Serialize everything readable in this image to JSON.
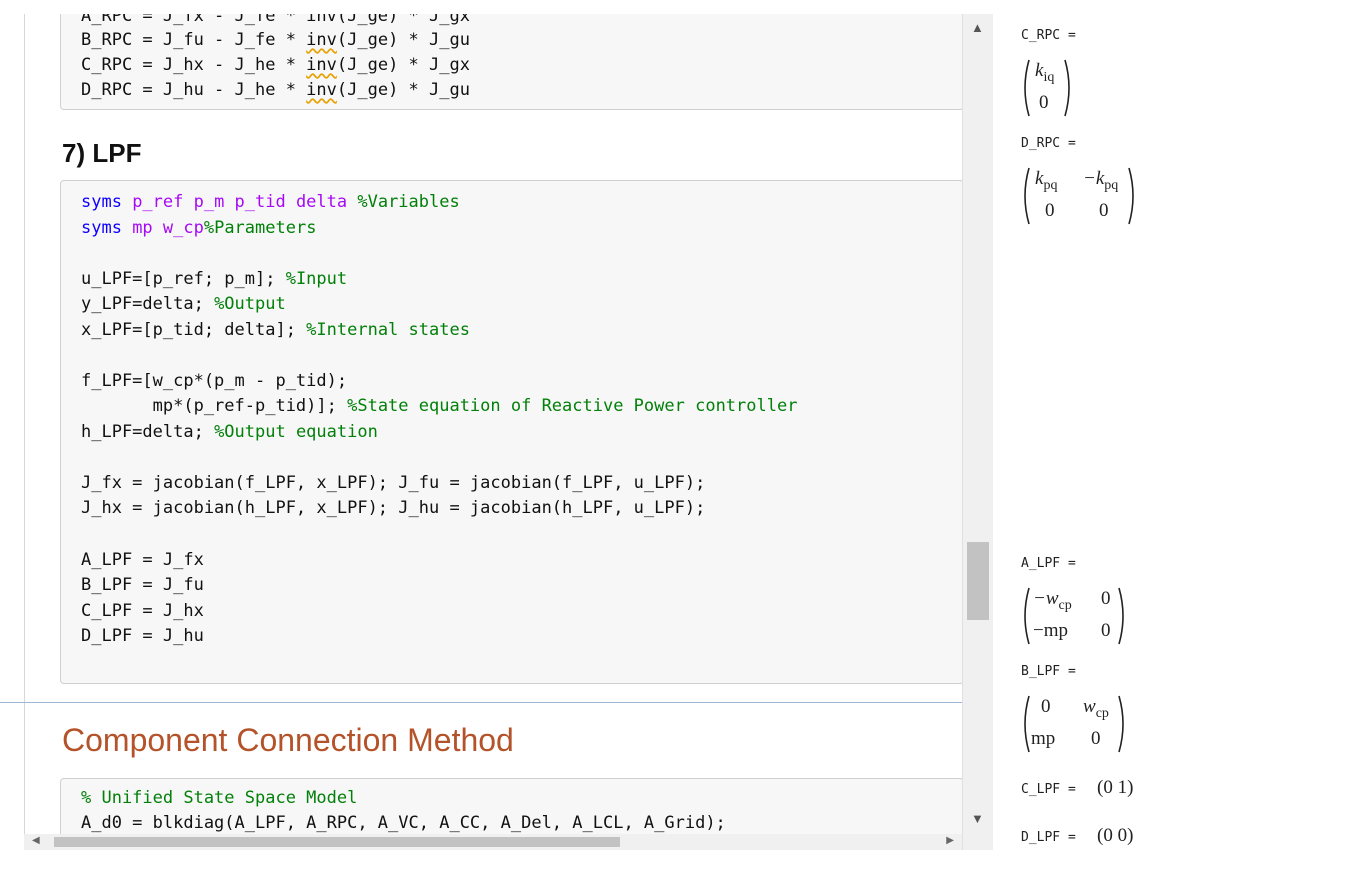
{
  "code_top": {
    "partial_line": "A_RPC = J_fx - J_fe * inv(J_ge) * J_gx",
    "lines": [
      {
        "pre": "B_RPC = J_fu - J_fe * ",
        "fn": "inv",
        "post": "(J_ge) * J_gu"
      },
      {
        "pre": "C_RPC = J_hx - J_he * ",
        "fn": "inv",
        "post": "(J_ge) * J_gx"
      },
      {
        "pre": "D_RPC = J_hu - J_he * ",
        "fn": "inv",
        "post": "(J_ge) * J_gu"
      }
    ]
  },
  "section7": {
    "title": "7) LPF"
  },
  "code_lpf": {
    "l1": {
      "kw": "syms ",
      "args": "p_ref p_m p_tid delta ",
      "comment": "%Variables"
    },
    "l2": {
      "kw": "syms ",
      "args": "mp w_cp",
      "comment": "%Parameters"
    },
    "l3": {
      "code": "u_LPF=[p_ref; p_m]; ",
      "comment": "%Input"
    },
    "l4": {
      "code": "y_LPF=delta; ",
      "comment": "%Output"
    },
    "l5": {
      "code": "x_LPF=[p_tid; delta]; ",
      "comment": "%Internal states"
    },
    "l6": {
      "code": "f_LPF=[w_cp*(p_m - p_tid);"
    },
    "l7": {
      "code": "       mp*(p_ref-p_tid)]; ",
      "comment": "%State equation of Reactive Power controller"
    },
    "l8": {
      "code": "h_LPF=delta; ",
      "comment": "%Output equation"
    },
    "l9": {
      "code": "J_fx = jacobian(f_LPF, x_LPF); J_fu = jacobian(f_LPF, u_LPF);"
    },
    "l10": {
      "code": "J_hx = jacobian(h_LPF, x_LPF); J_hu = jacobian(h_LPF, u_LPF);"
    },
    "l11": {
      "code": "A_LPF = J_fx"
    },
    "l12": {
      "code": "B_LPF = J_fu"
    },
    "l13": {
      "code": "C_LPF = J_hx"
    },
    "l14": {
      "code": "D_LPF = J_hu"
    }
  },
  "ccm": {
    "title": "Component Connection Method",
    "l1": {
      "comment": "% Unified State Space Model"
    },
    "l2": {
      "code": "A_d0 = blkdiag(A_LPF, A_RPC, A_VC, A_CC, A_Del, A_LCL, A_Grid);"
    }
  },
  "output": {
    "c_rpc": {
      "label": "C_RPC =",
      "r1": "k",
      "r1sub": "iq",
      "r2": "0"
    },
    "d_rpc": {
      "label": "D_RPC =",
      "a": "k",
      "asub": "pq",
      "b": "−k",
      "bsub": "pq",
      "c": "0",
      "d": "0"
    },
    "a_lpf": {
      "label": "A_LPF =",
      "a": "−w",
      "asub": "cp",
      "b": "0",
      "c": "−mp",
      "d": "0"
    },
    "b_lpf": {
      "label": "B_LPF =",
      "a": "0",
      "b": "w",
      "bsub": "cp",
      "c": "mp",
      "d": "0"
    },
    "c_lpf": {
      "label": "C_LPF =",
      "value": "(0   1)"
    },
    "d_lpf": {
      "label": "D_LPF =",
      "value": "(0   0)"
    }
  },
  "scroll": {
    "up_icon": "▲",
    "down_icon": "▼",
    "left_icon": "◀",
    "right_icon": "▶"
  }
}
